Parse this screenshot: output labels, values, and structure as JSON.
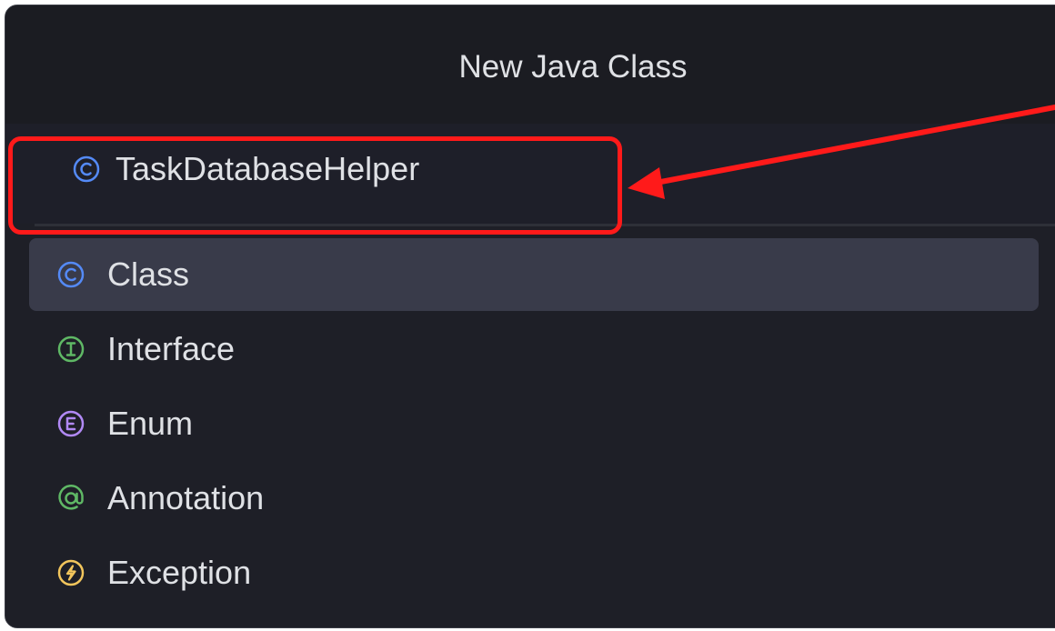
{
  "dialog": {
    "title": "New Java Class",
    "name_value": "TaskDatabaseHelper",
    "name_icon": "class-icon"
  },
  "kinds": [
    {
      "label": "Class",
      "icon": "class-icon",
      "color": "#548af7",
      "selected": true
    },
    {
      "label": "Interface",
      "icon": "interface-icon",
      "color": "#5fb865",
      "selected": false
    },
    {
      "label": "Enum",
      "icon": "enum-icon",
      "color": "#b189f5",
      "selected": false
    },
    {
      "label": "Annotation",
      "icon": "annotation-icon",
      "color": "#5fb865",
      "selected": false
    },
    {
      "label": "Exception",
      "icon": "exception-icon",
      "color": "#f2c55c",
      "selected": false
    }
  ],
  "annotation": {
    "highlight_color": "#ff1a1a"
  }
}
